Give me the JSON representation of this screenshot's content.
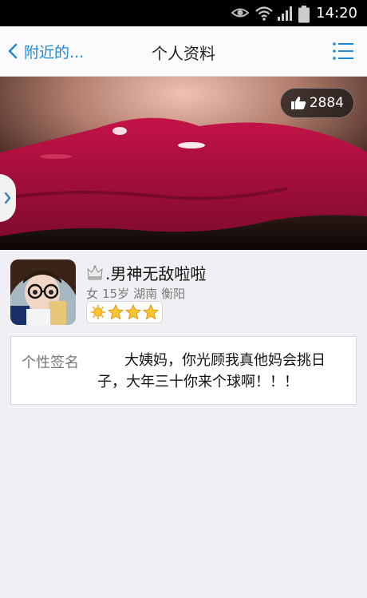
{
  "status_bar": {
    "time": "14:20",
    "icons": [
      "eye-icon",
      "wifi-icon",
      "signal-icon",
      "battery-icon"
    ]
  },
  "nav": {
    "back_label": "附近的...",
    "title": "个人资料",
    "menu_icon": "list-icon",
    "accent_color": "#1f8ad8"
  },
  "hero": {
    "likes": "2884",
    "like_icon": "thumbs-up-icon",
    "side_tab_icon": "chevron-right-icon"
  },
  "profile": {
    "badge_icon": "crown-icon",
    "name": ".男神无敌啦啦",
    "gender": "女",
    "age": "15岁",
    "province": "湖南",
    "city": "衡阳",
    "level_icons": [
      "sun-icon",
      "star-icon",
      "star-icon",
      "star-icon"
    ]
  },
  "signature": {
    "label": "个性签名",
    "text": "大姨妈，你光顾我真他妈会挑日子，大年三十你来个球啊！！！"
  }
}
